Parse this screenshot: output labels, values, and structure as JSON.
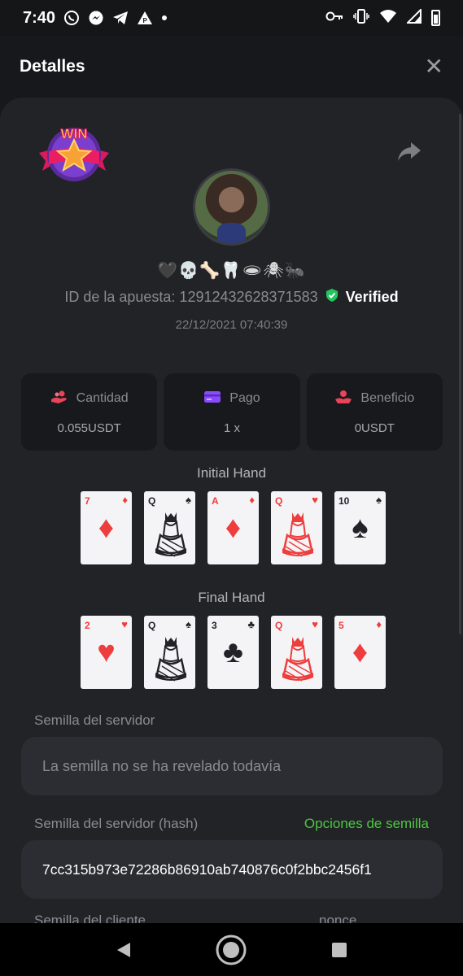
{
  "status_bar": {
    "time": "7:40",
    "left_icons": [
      "whatsapp-icon",
      "messenger-icon",
      "telegram-icon",
      "p-app-icon",
      "dot-icon"
    ],
    "right_icons": [
      "key-icon",
      "vibrate-icon",
      "wifi-icon",
      "signal-icon",
      "battery-icon"
    ]
  },
  "header": {
    "title": "Detalles",
    "close_symbol": "✕"
  },
  "bet": {
    "badge_text": "WIN",
    "username": "🖤💀🦴🦷🕳🕷🐜",
    "id_label": "ID de la apuesta: 12912432628371583",
    "verified_label": "Verified",
    "date": "22/12/2021 07:40:39"
  },
  "stats": [
    {
      "label": "Cantidad",
      "value": "0.055USDT",
      "icon": "coins-hand-icon",
      "color": "#e8445a"
    },
    {
      "label": "Pago",
      "value": "1 x",
      "icon": "card-icon",
      "color": "#8a4bff"
    },
    {
      "label": "Beneficio",
      "value": "0USDT",
      "icon": "profit-hand-icon",
      "color": "#e8445a"
    }
  ],
  "initial_hand": {
    "title": "Initial Hand",
    "cards": [
      {
        "rank": "7",
        "suit": "♦",
        "color": "red"
      },
      {
        "rank": "Q",
        "suit": "♠",
        "color": "black"
      },
      {
        "rank": "A",
        "suit": "♦",
        "color": "red"
      },
      {
        "rank": "Q",
        "suit": "♥",
        "color": "red"
      },
      {
        "rank": "10",
        "suit": "♠",
        "color": "black"
      }
    ]
  },
  "final_hand": {
    "title": "Final Hand",
    "cards": [
      {
        "rank": "2",
        "suit": "♥",
        "color": "red"
      },
      {
        "rank": "Q",
        "suit": "♠",
        "color": "black"
      },
      {
        "rank": "3",
        "suit": "♣",
        "color": "black"
      },
      {
        "rank": "Q",
        "suit": "♥",
        "color": "red"
      },
      {
        "rank": "5",
        "suit": "♦",
        "color": "red"
      }
    ]
  },
  "seeds": {
    "server_label": "Semilla del servidor",
    "server_placeholder": "La semilla no se ha revelado todavía",
    "server_hash_label": "Semilla del servidor (hash)",
    "seed_options_link": "Opciones de semilla",
    "server_hash_value": "7cc315b973e72286b86910ab740876c0f2bbc2456f1",
    "client_label": "Semilla del cliente",
    "nonce_label": "nonce"
  },
  "colors": {
    "accent_green": "#4bc73f",
    "verified_green": "#22c55e",
    "card_red": "#ee3d3d"
  }
}
